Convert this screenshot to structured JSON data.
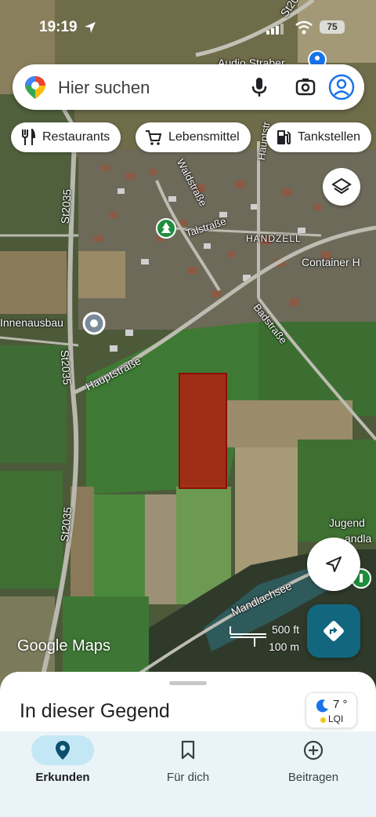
{
  "status_bar": {
    "time": "19:19",
    "battery": "75"
  },
  "search": {
    "placeholder": "Hier suchen"
  },
  "chips": [
    {
      "label": "Restaurants",
      "icon": "fork-knife-icon"
    },
    {
      "label": "Lebensmittel",
      "icon": "cart-icon"
    },
    {
      "label": "Tankstellen",
      "icon": "fuel-icon"
    }
  ],
  "map": {
    "labels": {
      "st2035_top": "St2035",
      "st2035_mid": "St2035",
      "st2035_bottom": "St2035",
      "st20_top": "St20",
      "waldstrasse": "Waldstraße",
      "talstrasse": "Talstraße",
      "hauptstrasse_north": "Hauptstr",
      "hauptstrasse": "Hauptstraße",
      "handzell": "HANDZELL",
      "container": "Container H",
      "innenausbau": "Innenausbau",
      "badstrasse": "Badstraße",
      "mandlachsee": "Mandlachsee",
      "jugend": "Jugend",
      "mandla": "andla",
      "audio": "Audio Straber"
    },
    "scale": {
      "feet": "500 ft",
      "meters": "100 m"
    },
    "watermark": "Google Maps",
    "highlight_color": "#c0150e"
  },
  "sheet": {
    "title": "In dieser Gegend"
  },
  "weather": {
    "temperature": "7 °",
    "aqi": "LQI"
  },
  "nav": [
    {
      "label": "Erkunden",
      "active": true
    },
    {
      "label": "Für dich",
      "active": false
    },
    {
      "label": "Beitragen",
      "active": false
    }
  ]
}
